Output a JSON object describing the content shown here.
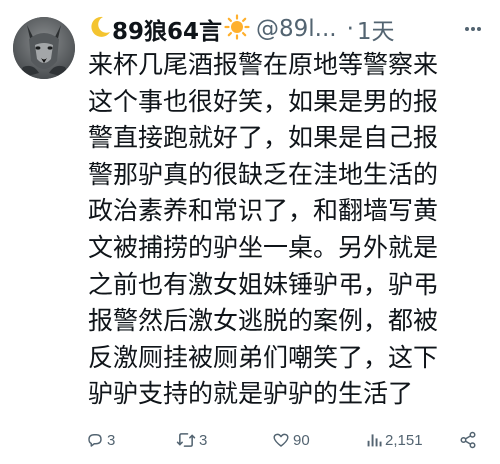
{
  "tweet": {
    "display_name": "89狼64言",
    "handle": "@89l...",
    "separator": "·",
    "time": "1天",
    "body_lines": [
      "来杯几尾酒报警在原地等警察来",
      "这个事也很好笑，如果是男的报",
      "警直接跑就好了，如果是自己报",
      "警那驴真的很缺乏在洼地生活的",
      "政治素养和常识了，和翻墙写黄",
      "文被捕捞的驴坐一桌。另外就是",
      "之前也有激女姐妹锤驴弔，驴弔",
      "报警然后激女逃脱的案例，都被",
      "反激厕挂被厕弟们嘲笑了，这下",
      "驴驴支持的就是驴驴的生活了"
    ]
  },
  "actions": {
    "reply_count": "3",
    "retweet_count": "3",
    "like_count": "90",
    "view_count": "2,151"
  },
  "icons": {
    "name_prefix": "crescent-moon-icon",
    "name_suffix": "sun-icon",
    "more": "more-icon",
    "reply": "reply-icon",
    "retweet": "retweet-icon",
    "like": "heart-icon",
    "views": "views-icon",
    "share": "share-icon"
  },
  "colors": {
    "text": "#0f1419",
    "secondary": "#536471",
    "moon": "#f4c430",
    "sun": "#ffb02e"
  }
}
